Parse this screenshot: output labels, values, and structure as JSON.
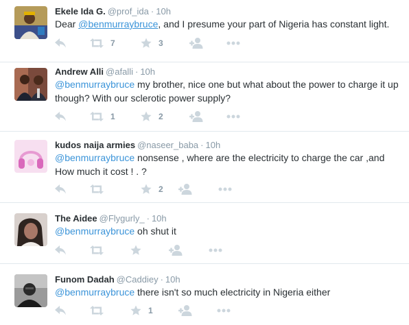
{
  "tweets": [
    {
      "fullname": "Ekele Ida G.",
      "handle": "@prof_ida",
      "separator": "·",
      "time": "10h",
      "text_before": "Dear ",
      "mention": "@benmurraybruce",
      "text_after": ", and I presume your part of Nigeria has constant light.",
      "retweet_count": "7",
      "favorite_count": "3"
    },
    {
      "fullname": "Andrew Alli",
      "handle": "@afalli",
      "separator": "·",
      "time": "10h",
      "text_before": "",
      "mention": "@benmurraybruce",
      "text_after": " my brother, nice one but what about the power to charge it up though? With our sclerotic power supply?",
      "retweet_count": "1",
      "favorite_count": "2"
    },
    {
      "fullname": "kudos naija armies",
      "handle": "@naseer_baba",
      "separator": "·",
      "time": "10h",
      "text_before": "",
      "mention": "@benmurraybruce",
      "text_after": " nonsense , where are  the electricity to charge the car ,and How much it cost ! . ?",
      "retweet_count": "",
      "favorite_count": "2"
    },
    {
      "fullname": "The Aidee",
      "handle": "@Flygurly_",
      "separator": "·",
      "time": "10h",
      "text_before": "",
      "mention": "@benmurraybruce",
      "text_after": " oh shut it",
      "retweet_count": "",
      "favorite_count": ""
    },
    {
      "fullname": "Funom Dadah",
      "handle": "@Caddiey",
      "separator": "·",
      "time": "10h",
      "text_before": "",
      "mention": "@benmurraybruce",
      "text_after": " there isn't so much electricity in Nigeria either",
      "retweet_count": "",
      "favorite_count": "1"
    }
  ],
  "icons": {
    "reply": "reply-icon",
    "retweet": "retweet-icon",
    "favorite": "star-icon",
    "follow": "follow-icon",
    "more": "more-icon"
  },
  "colors": {
    "name": "#292f33",
    "meta": "#8899a6",
    "mention": "#3b94d9",
    "action_icon": "#ccd6dd",
    "divider": "#e1e8ed"
  }
}
